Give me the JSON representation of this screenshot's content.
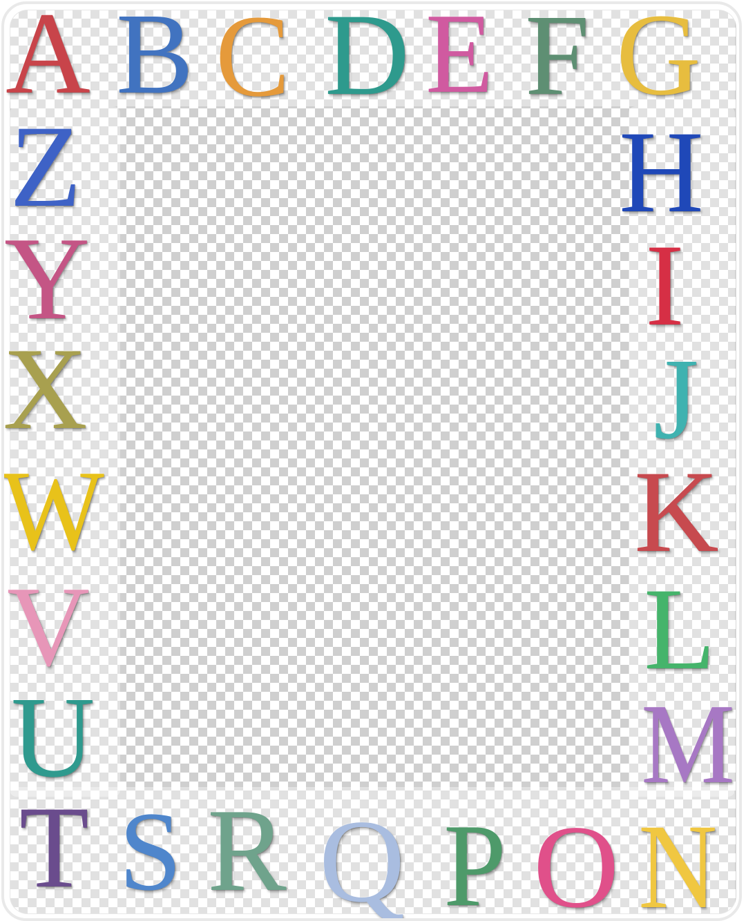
{
  "letters": [
    {
      "id": "A",
      "char": "A",
      "color": "#c8444a"
    },
    {
      "id": "B",
      "char": "B",
      "color": "#4173c0"
    },
    {
      "id": "C",
      "char": "C",
      "color": "#e59a3b"
    },
    {
      "id": "D",
      "char": "D",
      "color": "#2e9a8d"
    },
    {
      "id": "E",
      "char": "E",
      "color": "#d05aa0"
    },
    {
      "id": "F",
      "char": "F",
      "color": "#5e8f73"
    },
    {
      "id": "G",
      "char": "G",
      "color": "#e7bd3f"
    },
    {
      "id": "H",
      "char": "H",
      "color": "#1f48b8"
    },
    {
      "id": "I",
      "char": "I",
      "color": "#d62f45"
    },
    {
      "id": "J",
      "char": "J",
      "color": "#3fb2b0"
    },
    {
      "id": "K",
      "char": "K",
      "color": "#c74a4f"
    },
    {
      "id": "L",
      "char": "L",
      "color": "#45b46b"
    },
    {
      "id": "M",
      "char": "M",
      "color": "#a778c4"
    },
    {
      "id": "N",
      "char": "N",
      "color": "#f0c741"
    },
    {
      "id": "O",
      "char": "O",
      "color": "#e0508a"
    },
    {
      "id": "P",
      "char": "P",
      "color": "#4e9a6a"
    },
    {
      "id": "Q",
      "char": "Q",
      "color": "#a9bde0"
    },
    {
      "id": "R",
      "char": "R",
      "color": "#6fa38c"
    },
    {
      "id": "S",
      "char": "S",
      "color": "#4f86cc"
    },
    {
      "id": "T",
      "char": "T",
      "color": "#6a4c8d"
    },
    {
      "id": "U",
      "char": "U",
      "color": "#2f9a8e"
    },
    {
      "id": "V",
      "char": "V",
      "color": "#e796b8"
    },
    {
      "id": "W",
      "char": "W",
      "color": "#e8c21a"
    },
    {
      "id": "X",
      "char": "X",
      "color": "#a8a04f"
    },
    {
      "id": "Y",
      "char": "Y",
      "color": "#c45585"
    },
    {
      "id": "Z",
      "char": "Z",
      "color": "#3e62c6"
    }
  ]
}
